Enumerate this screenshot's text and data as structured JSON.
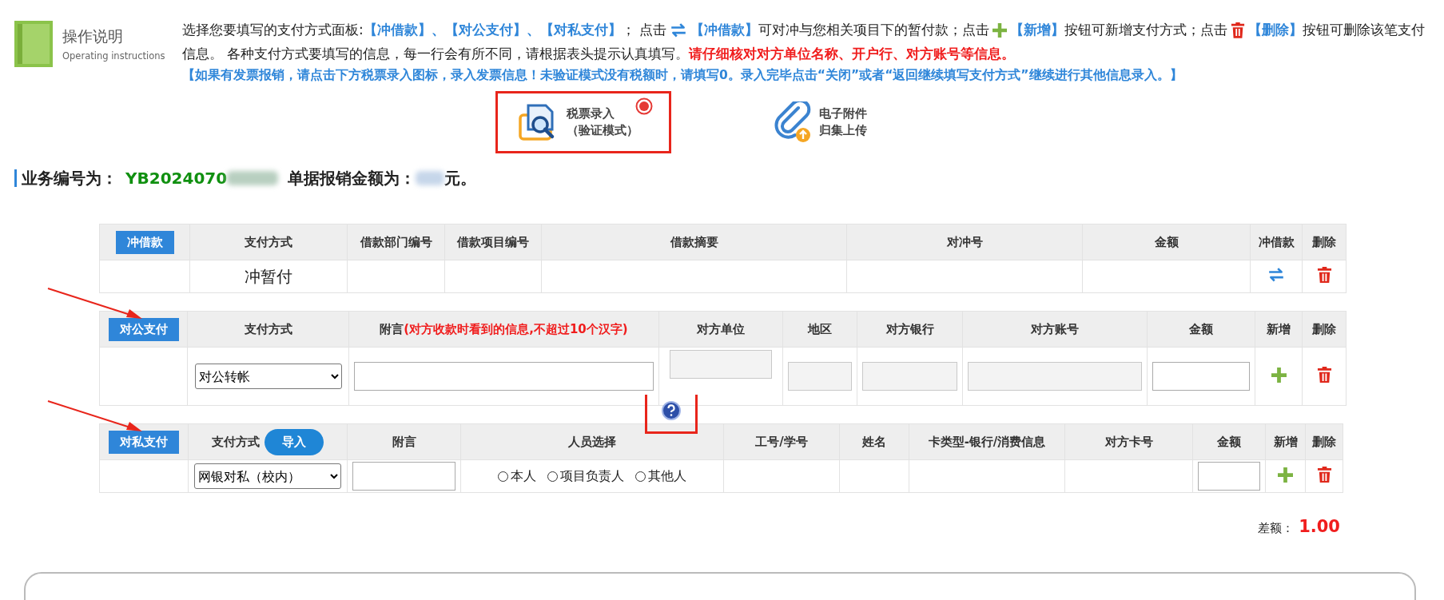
{
  "instructions": {
    "title": "操作说明",
    "subtitle": "Operating instructions",
    "segments": [
      {
        "kind": "text",
        "text": "选择您要填写的支付方式面板:"
      },
      {
        "kind": "tag",
        "text": "【冲借款】、【对公支付】、【对私支付】"
      },
      {
        "kind": "text",
        "text": "； 点击"
      },
      {
        "kind": "swap-icon"
      },
      {
        "kind": "tag",
        "text": "【冲借款】"
      },
      {
        "kind": "text",
        "text": "可对冲与您相关项目下的暂付款；点击"
      },
      {
        "kind": "plus-icon"
      },
      {
        "kind": "tag",
        "text": "【新增】"
      },
      {
        "kind": "text",
        "text": "按钮可新增支付方式；点击"
      },
      {
        "kind": "trash-icon"
      },
      {
        "kind": "tag",
        "text": "【删除】"
      },
      {
        "kind": "text",
        "text": "按钮可删除该笔支付信息。 各种支付方式要填写的信息，每一行会有所不同，请根据表头提示认真填写。"
      },
      {
        "kind": "warn",
        "text": "请仔细核对对方单位名称、开户行、对方账号等信息。"
      }
    ],
    "notice": "【如果有发票报销，请点击下方税票录入图标，录入发票信息！未验证模式没有税额时，请填写0。录入完毕点击“关闭”或者“返回继续填写支付方式”继续进行其他信息录入。】"
  },
  "tools": [
    {
      "kind": "invoice",
      "label": "税票录入",
      "sublabel": "（验证模式）",
      "highlighted": true
    },
    {
      "kind": "attachment",
      "label": "电子附件",
      "sublabel": "归集上传",
      "highlighted": false
    }
  ],
  "business": {
    "number_label": "业务编号为：",
    "number": "YB2024070",
    "number_redacted": true,
    "amount_label": "单据报销金额为：",
    "amount_redacted": true,
    "amount_suffix": "元。"
  },
  "tables": [
    {
      "tag": "冲借款",
      "annotated": false,
      "columns": [
        {
          "text": "支付方式"
        },
        {
          "text": "借款部门编号"
        },
        {
          "text": "借款项目编号"
        },
        {
          "text": "借款摘要"
        },
        {
          "text": "对冲号"
        },
        {
          "text": "金额"
        },
        {
          "text": "冲借款"
        },
        {
          "text": "删除"
        }
      ],
      "cells": [
        {
          "kind": "text",
          "text": "冲暂付"
        },
        {
          "kind": "empty"
        },
        {
          "kind": "empty"
        },
        {
          "kind": "empty"
        },
        {
          "kind": "empty"
        },
        {
          "kind": "empty"
        },
        {
          "kind": "swap"
        },
        {
          "kind": "trash"
        }
      ]
    },
    {
      "tag": "对公支付",
      "annotated": true,
      "columns": [
        {
          "text": "支付方式"
        },
        {
          "text": "附言",
          "note": "(对方收款时看到的信息,不超过10个汉字)"
        },
        {
          "text": "对方单位"
        },
        {
          "text": "地区"
        },
        {
          "text": "对方银行"
        },
        {
          "text": "对方账号"
        },
        {
          "text": "金额"
        },
        {
          "text": "新增"
        },
        {
          "text": "删除"
        }
      ],
      "cells": [
        {
          "kind": "select",
          "value": "对公转帐"
        },
        {
          "kind": "input",
          "disabled": false
        },
        {
          "kind": "input",
          "disabled": true,
          "help": true,
          "highlighted": true
        },
        {
          "kind": "input",
          "disabled": true
        },
        {
          "kind": "input",
          "disabled": true
        },
        {
          "kind": "input",
          "disabled": true
        },
        {
          "kind": "input",
          "disabled": false
        },
        {
          "kind": "plus"
        },
        {
          "kind": "trash"
        }
      ]
    },
    {
      "tag": "对私支付",
      "annotated": true,
      "columns": [
        {
          "text": "支付方式",
          "button": "导入"
        },
        {
          "text": "附言"
        },
        {
          "text": "人员选择"
        },
        {
          "text": "工号/学号"
        },
        {
          "text": "姓名"
        },
        {
          "text": "卡类型-银行/消费信息"
        },
        {
          "text": "对方卡号"
        },
        {
          "text": "金额"
        },
        {
          "text": "新增"
        },
        {
          "text": "删除"
        }
      ],
      "cells": [
        {
          "kind": "select",
          "value": "网银对私（校内）"
        },
        {
          "kind": "input",
          "disabled": false
        },
        {
          "kind": "radios",
          "options": [
            {
              "label": "本人",
              "selected": false
            },
            {
              "label": "项目负责人",
              "selected": false
            },
            {
              "label": "其他人",
              "selected": false
            }
          ]
        },
        {
          "kind": "empty"
        },
        {
          "kind": "empty"
        },
        {
          "kind": "empty"
        },
        {
          "kind": "empty"
        },
        {
          "kind": "input",
          "disabled": false
        },
        {
          "kind": "plus"
        },
        {
          "kind": "trash"
        }
      ]
    }
  ],
  "difference": {
    "label": "差额：",
    "value": "1.00"
  }
}
